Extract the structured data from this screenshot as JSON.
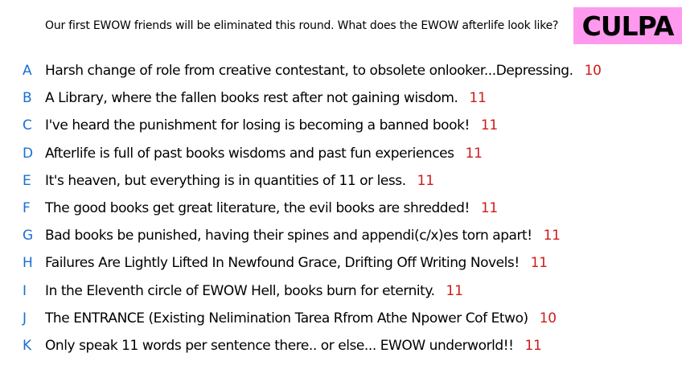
{
  "prompt": "Our first EWOW friends will be eliminated this round. What does the EWOW afterlife look like?",
  "badge": {
    "label": "CULPA",
    "background": "#ff99ee",
    "color": "#000000"
  },
  "colors": {
    "letter": "#1a6fd6",
    "score": "#d11a1a"
  },
  "responses": [
    {
      "letter": "A",
      "text": "Harsh change of role from creative contestant, to obsolete onlooker...Depressing.",
      "score": "10"
    },
    {
      "letter": "B",
      "text": "A Library, where the fallen books rest after not gaining wisdom.",
      "score": "11"
    },
    {
      "letter": "C",
      "text": "I've heard the punishment for losing is becoming a banned book!",
      "score": "11"
    },
    {
      "letter": "D",
      "text": "Afterlife is full of past books wisdoms and past fun experiences",
      "score": "11"
    },
    {
      "letter": "E",
      "text": "It's heaven, but everything is in quantities of 11 or less.",
      "score": "11"
    },
    {
      "letter": "F",
      "text": "The good books get great literature, the evil books are shredded!",
      "score": "11"
    },
    {
      "letter": "G",
      "text": "Bad books be punished, having their spines and appendi(c/x)es torn apart!",
      "score": "11"
    },
    {
      "letter": "H",
      "text": "Failures Are Lightly Lifted In Newfound Grace, Drifting Off Writing Novels!",
      "score": "11"
    },
    {
      "letter": "I",
      "text": "In the Eleventh circle of EWOW Hell, books burn for eternity.",
      "score": "11"
    },
    {
      "letter": "J",
      "text": "The ENTRANCE (Existing Nelimination Tarea Rfrom Athe Npower Cof Etwo)",
      "score": "10"
    },
    {
      "letter": "K",
      "text": "Only speak 11 words per sentence there.. or else... EWOW underworld!!",
      "score": "11"
    }
  ]
}
